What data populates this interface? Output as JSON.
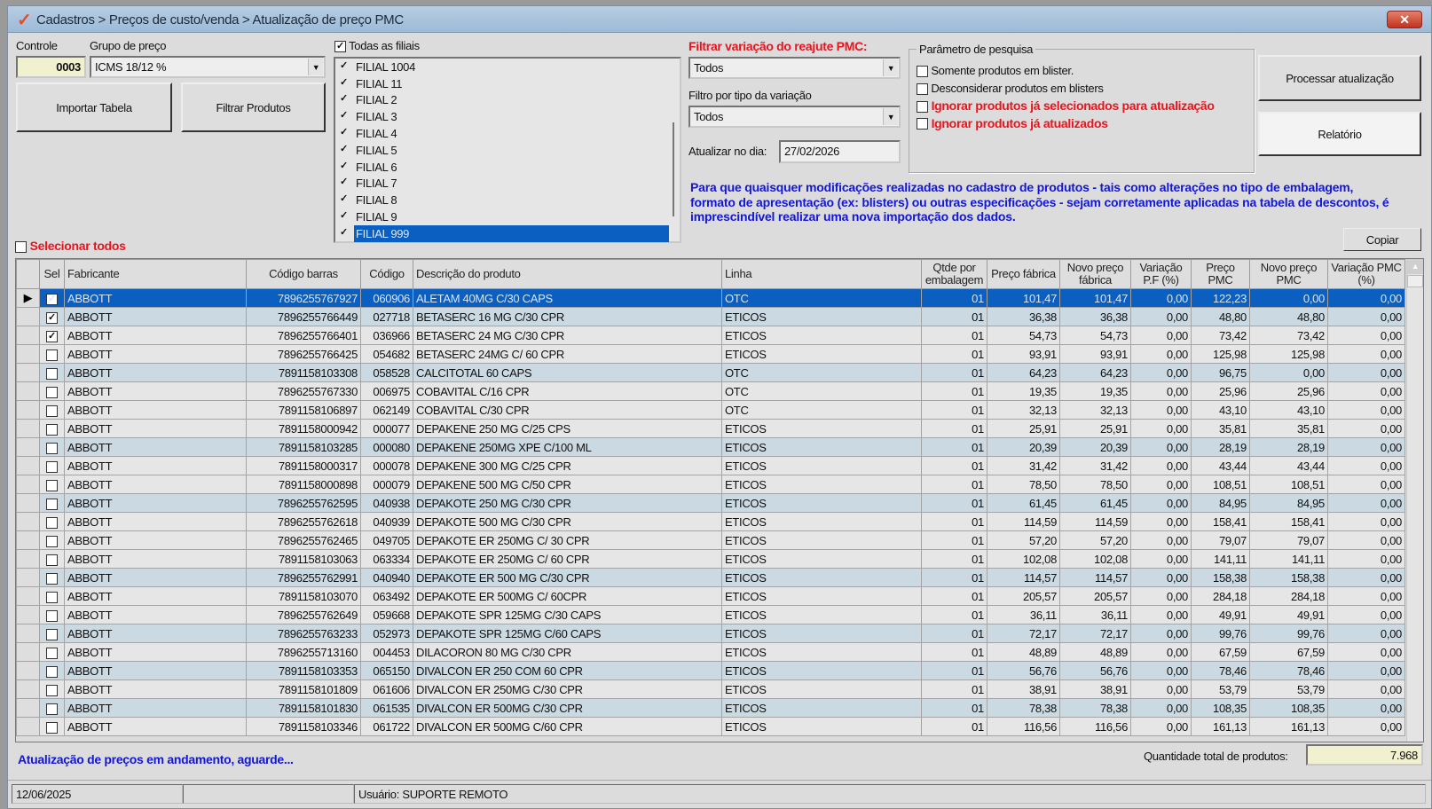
{
  "window": {
    "title": "Cadastros > Preços de custo/venda > Atualização de preço PMC",
    "close": "✕"
  },
  "controle": {
    "label": "Controle",
    "value": "0003"
  },
  "grupo": {
    "label": "Grupo de preço",
    "value": "ICMS 18/12 %"
  },
  "buttons": {
    "importar": "Importar Tabela",
    "filtrar": "Filtrar Produtos",
    "processar": "Processar atualização",
    "relatorio": "Relatório",
    "copiar": "Copiar"
  },
  "filiais": {
    "all_label": "Todas as filiais",
    "all_checked": true,
    "items": [
      {
        "label": "FILIAL 1004"
      },
      {
        "label": "FILIAL 11"
      },
      {
        "label": "FILIAL 2"
      },
      {
        "label": "FILIAL 3"
      },
      {
        "label": "FILIAL 4"
      },
      {
        "label": "FILIAL 5"
      },
      {
        "label": "FILIAL 6"
      },
      {
        "label": "FILIAL 7"
      },
      {
        "label": "FILIAL 8"
      },
      {
        "label": "FILIAL 9"
      },
      {
        "label": "FILIAL 999",
        "selected": true
      }
    ]
  },
  "filtro_variacao": {
    "label": "Filtrar variação do reajute PMC:",
    "value": "Todos"
  },
  "filtro_tipo": {
    "label": "Filtro por tipo da variação",
    "value": "Todos"
  },
  "atualizar": {
    "label": "Atualizar no dia:",
    "value": "27/02/2026"
  },
  "parametros": {
    "legend": "Parâmetro de pesquisa",
    "options": [
      {
        "label": "Somente produtos em blister.",
        "red": false
      },
      {
        "label": "Desconsiderar produtos em blisters",
        "red": false
      },
      {
        "label": "Ignorar produtos já selecionados para atualização",
        "red": true
      },
      {
        "label": "Ignorar produtos já atualizados",
        "red": true
      }
    ]
  },
  "note": "Para que quaisquer modificações realizadas no cadastro de produtos - tais como alterações no tipo de embalagem, formato de apresentação (ex: blisters) ou outras especificações - sejam corretamente aplicadas na tabela de descontos, é imprescindível realizar uma nova importação dos dados.",
  "selecionar_todos": "Selecionar todos",
  "table": {
    "columns": [
      "Sel",
      "Fabricante",
      "Código barras",
      "Código",
      "Descrição do produto",
      "Linha",
      "Qtde por embalagem",
      "Preço fábrica",
      "Novo preço fábrica",
      "Variação P.F (%)",
      "Preço PMC",
      "Novo preço PMC",
      "Variação PMC (%)"
    ],
    "rows": [
      {
        "band": "s",
        "sel": true,
        "fab": "ABBOTT",
        "barras": "7896255767927",
        "cod": "060906",
        "desc": "ALETAM 40MG C/30 CAPS",
        "linha": "OTC",
        "qtde": "01",
        "pf": "101,47",
        "npf": "101,47",
        "vpf": "0,00",
        "pmc": "122,23",
        "npmc": "0,00",
        "vpmc": "0,00"
      },
      {
        "band": "b",
        "sel": true,
        "fab": "ABBOTT",
        "barras": "7896255766449",
        "cod": "027718",
        "desc": "BETASERC 16 MG C/30 CPR",
        "linha": "ETICOS",
        "qtde": "01",
        "pf": "36,38",
        "npf": "36,38",
        "vpf": "0,00",
        "pmc": "48,80",
        "npmc": "48,80",
        "vpmc": "0,00"
      },
      {
        "band": "g",
        "sel": true,
        "fab": "ABBOTT",
        "barras": "7896255766401",
        "cod": "036966",
        "desc": "BETASERC 24 MG C/30 CPR",
        "linha": "ETICOS",
        "qtde": "01",
        "pf": "54,73",
        "npf": "54,73",
        "vpf": "0,00",
        "pmc": "73,42",
        "npmc": "73,42",
        "vpmc": "0,00"
      },
      {
        "band": "g",
        "sel": false,
        "fab": "ABBOTT",
        "barras": "7896255766425",
        "cod": "054682",
        "desc": "BETASERC 24MG C/ 60 CPR",
        "linha": "ETICOS",
        "qtde": "01",
        "pf": "93,91",
        "npf": "93,91",
        "vpf": "0,00",
        "pmc": "125,98",
        "npmc": "125,98",
        "vpmc": "0,00"
      },
      {
        "band": "b",
        "sel": false,
        "fab": "ABBOTT",
        "barras": "7891158103308",
        "cod": "058528",
        "desc": "CALCITOTAL 60 CAPS",
        "linha": "OTC",
        "qtde": "01",
        "pf": "64,23",
        "npf": "64,23",
        "vpf": "0,00",
        "pmc": "96,75",
        "npmc": "0,00",
        "vpmc": "0,00"
      },
      {
        "band": "g",
        "sel": false,
        "fab": "ABBOTT",
        "barras": "7896255767330",
        "cod": "006975",
        "desc": "COBAVITAL C/16 CPR",
        "linha": "OTC",
        "qtde": "01",
        "pf": "19,35",
        "npf": "19,35",
        "vpf": "0,00",
        "pmc": "25,96",
        "npmc": "25,96",
        "vpmc": "0,00"
      },
      {
        "band": "g",
        "sel": false,
        "fab": "ABBOTT",
        "barras": "7891158106897",
        "cod": "062149",
        "desc": "COBAVITAL C/30 CPR",
        "linha": "OTC",
        "qtde": "01",
        "pf": "32,13",
        "npf": "32,13",
        "vpf": "0,00",
        "pmc": "43,10",
        "npmc": "43,10",
        "vpmc": "0,00"
      },
      {
        "band": "g",
        "sel": false,
        "fab": "ABBOTT",
        "barras": "7891158000942",
        "cod": "000077",
        "desc": "DEPAKENE 250 MG C/25 CPS",
        "linha": "ETICOS",
        "qtde": "01",
        "pf": "25,91",
        "npf": "25,91",
        "vpf": "0,00",
        "pmc": "35,81",
        "npmc": "35,81",
        "vpmc": "0,00"
      },
      {
        "band": "b",
        "sel": false,
        "fab": "ABBOTT",
        "barras": "7891158103285",
        "cod": "000080",
        "desc": "DEPAKENE 250MG XPE C/100 ML",
        "linha": "ETICOS",
        "qtde": "01",
        "pf": "20,39",
        "npf": "20,39",
        "vpf": "0,00",
        "pmc": "28,19",
        "npmc": "28,19",
        "vpmc": "0,00"
      },
      {
        "band": "g",
        "sel": false,
        "fab": "ABBOTT",
        "barras": "7891158000317",
        "cod": "000078",
        "desc": "DEPAKENE 300 MG C/25 CPR",
        "linha": "ETICOS",
        "qtde": "01",
        "pf": "31,42",
        "npf": "31,42",
        "vpf": "0,00",
        "pmc": "43,44",
        "npmc": "43,44",
        "vpmc": "0,00"
      },
      {
        "band": "g",
        "sel": false,
        "fab": "ABBOTT",
        "barras": "7891158000898",
        "cod": "000079",
        "desc": "DEPAKENE 500 MG C/50 CPR",
        "linha": "ETICOS",
        "qtde": "01",
        "pf": "78,50",
        "npf": "78,50",
        "vpf": "0,00",
        "pmc": "108,51",
        "npmc": "108,51",
        "vpmc": "0,00"
      },
      {
        "band": "b",
        "sel": false,
        "fab": "ABBOTT",
        "barras": "7896255762595",
        "cod": "040938",
        "desc": "DEPAKOTE 250 MG C/30 CPR",
        "linha": "ETICOS",
        "qtde": "01",
        "pf": "61,45",
        "npf": "61,45",
        "vpf": "0,00",
        "pmc": "84,95",
        "npmc": "84,95",
        "vpmc": "0,00"
      },
      {
        "band": "g",
        "sel": false,
        "fab": "ABBOTT",
        "barras": "7896255762618",
        "cod": "040939",
        "desc": "DEPAKOTE 500 MG C/30 CPR",
        "linha": "ETICOS",
        "qtde": "01",
        "pf": "114,59",
        "npf": "114,59",
        "vpf": "0,00",
        "pmc": "158,41",
        "npmc": "158,41",
        "vpmc": "0,00"
      },
      {
        "band": "g",
        "sel": false,
        "fab": "ABBOTT",
        "barras": "7896255762465",
        "cod": "049705",
        "desc": "DEPAKOTE ER 250MG C/ 30 CPR",
        "linha": "ETICOS",
        "qtde": "01",
        "pf": "57,20",
        "npf": "57,20",
        "vpf": "0,00",
        "pmc": "79,07",
        "npmc": "79,07",
        "vpmc": "0,00"
      },
      {
        "band": "g",
        "sel": false,
        "fab": "ABBOTT",
        "barras": "7891158103063",
        "cod": "063334",
        "desc": "DEPAKOTE ER 250MG C/ 60 CPR",
        "linha": "ETICOS",
        "qtde": "01",
        "pf": "102,08",
        "npf": "102,08",
        "vpf": "0,00",
        "pmc": "141,11",
        "npmc": "141,11",
        "vpmc": "0,00"
      },
      {
        "band": "b",
        "sel": false,
        "fab": "ABBOTT",
        "barras": "7896255762991",
        "cod": "040940",
        "desc": "DEPAKOTE ER 500 MG C/30 CPR",
        "linha": "ETICOS",
        "qtde": "01",
        "pf": "114,57",
        "npf": "114,57",
        "vpf": "0,00",
        "pmc": "158,38",
        "npmc": "158,38",
        "vpmc": "0,00"
      },
      {
        "band": "g",
        "sel": false,
        "fab": "ABBOTT",
        "barras": "7891158103070",
        "cod": "063492",
        "desc": "DEPAKOTE ER 500MG C/ 60CPR",
        "linha": "ETICOS",
        "qtde": "01",
        "pf": "205,57",
        "npf": "205,57",
        "vpf": "0,00",
        "pmc": "284,18",
        "npmc": "284,18",
        "vpmc": "0,00"
      },
      {
        "band": "g",
        "sel": false,
        "fab": "ABBOTT",
        "barras": "7896255762649",
        "cod": "059668",
        "desc": "DEPAKOTE SPR 125MG C/30 CAPS",
        "linha": "ETICOS",
        "qtde": "01",
        "pf": "36,11",
        "npf": "36,11",
        "vpf": "0,00",
        "pmc": "49,91",
        "npmc": "49,91",
        "vpmc": "0,00"
      },
      {
        "band": "b",
        "sel": false,
        "fab": "ABBOTT",
        "barras": "7896255763233",
        "cod": "052973",
        "desc": "DEPAKOTE SPR 125MG C/60 CAPS",
        "linha": "ETICOS",
        "qtde": "01",
        "pf": "72,17",
        "npf": "72,17",
        "vpf": "0,00",
        "pmc": "99,76",
        "npmc": "99,76",
        "vpmc": "0,00"
      },
      {
        "band": "g",
        "sel": false,
        "fab": "ABBOTT",
        "barras": "7896255713160",
        "cod": "004453",
        "desc": "DILACORON 80 MG C/30 CPR",
        "linha": "ETICOS",
        "qtde": "01",
        "pf": "48,89",
        "npf": "48,89",
        "vpf": "0,00",
        "pmc": "67,59",
        "npmc": "67,59",
        "vpmc": "0,00"
      },
      {
        "band": "b",
        "sel": false,
        "fab": "ABBOTT",
        "barras": "7891158103353",
        "cod": "065150",
        "desc": "DIVALCON ER 250 COM 60 CPR",
        "linha": "ETICOS",
        "qtde": "01",
        "pf": "56,76",
        "npf": "56,76",
        "vpf": "0,00",
        "pmc": "78,46",
        "npmc": "78,46",
        "vpmc": "0,00"
      },
      {
        "band": "g",
        "sel": false,
        "fab": "ABBOTT",
        "barras": "7891158101809",
        "cod": "061606",
        "desc": "DIVALCON ER 250MG C/30 CPR",
        "linha": "ETICOS",
        "qtde": "01",
        "pf": "38,91",
        "npf": "38,91",
        "vpf": "0,00",
        "pmc": "53,79",
        "npmc": "53,79",
        "vpmc": "0,00"
      },
      {
        "band": "b",
        "sel": false,
        "fab": "ABBOTT",
        "barras": "7891158101830",
        "cod": "061535",
        "desc": "DIVALCON ER 500MG C/30 CPR",
        "linha": "ETICOS",
        "qtde": "01",
        "pf": "78,38",
        "npf": "78,38",
        "vpf": "0,00",
        "pmc": "108,35",
        "npmc": "108,35",
        "vpmc": "0,00"
      },
      {
        "band": "g",
        "sel": false,
        "fab": "ABBOTT",
        "barras": "7891158103346",
        "cod": "061722",
        "desc": "DIVALCON ER 500MG C/60 CPR",
        "linha": "ETICOS",
        "qtde": "01",
        "pf": "116,56",
        "npf": "116,56",
        "vpf": "0,00",
        "pmc": "161,13",
        "npmc": "161,13",
        "vpmc": "0,00"
      }
    ]
  },
  "status_message": "Atualização de preços em andamento, aguarde...",
  "quantidade": {
    "label": "Quantidade total de produtos:",
    "value": "7.968"
  },
  "statusbar": {
    "date": "12/06/2025",
    "empty": "",
    "user": "Usuário: SUPORTE REMOTO"
  }
}
